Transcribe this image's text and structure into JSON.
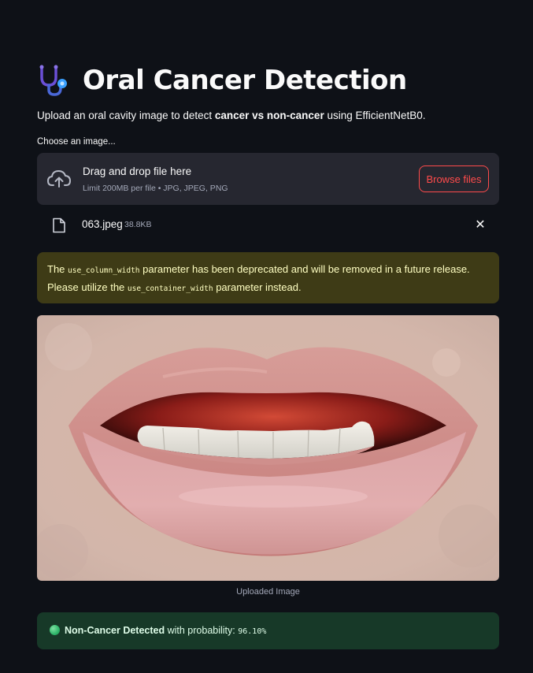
{
  "header": {
    "title": "Oral Cancer Detection",
    "icon": "stethoscope-icon"
  },
  "subtitle": {
    "prefix": "Upload an oral cavity image to detect ",
    "bold": "cancer vs non-cancer",
    "suffix": " using EfficientNetB0."
  },
  "uploader": {
    "label": "Choose an image...",
    "drop_title": "Drag and drop file here",
    "limit": "Limit 200MB per file • JPG, JPEG, PNG",
    "browse_label": "Browse files"
  },
  "file": {
    "name": "063.jpeg",
    "size": "38.8KB",
    "remove_label": "✕"
  },
  "warning": {
    "part1": "The ",
    "code1": "use_column_width",
    "part2": " parameter has been deprecated and will be removed in a future release. Please utilize the ",
    "code2": "use_container_width",
    "part3": " parameter instead."
  },
  "image": {
    "caption": "Uploaded Image"
  },
  "result": {
    "label": "Non-Cancer Detected",
    "middle": " with probability: ",
    "probability": "96.10%"
  },
  "colors": {
    "background": "#0e1117",
    "accent": "#ff4b4b",
    "warning_bg": "#3e3b16",
    "success_bg": "#173928"
  }
}
